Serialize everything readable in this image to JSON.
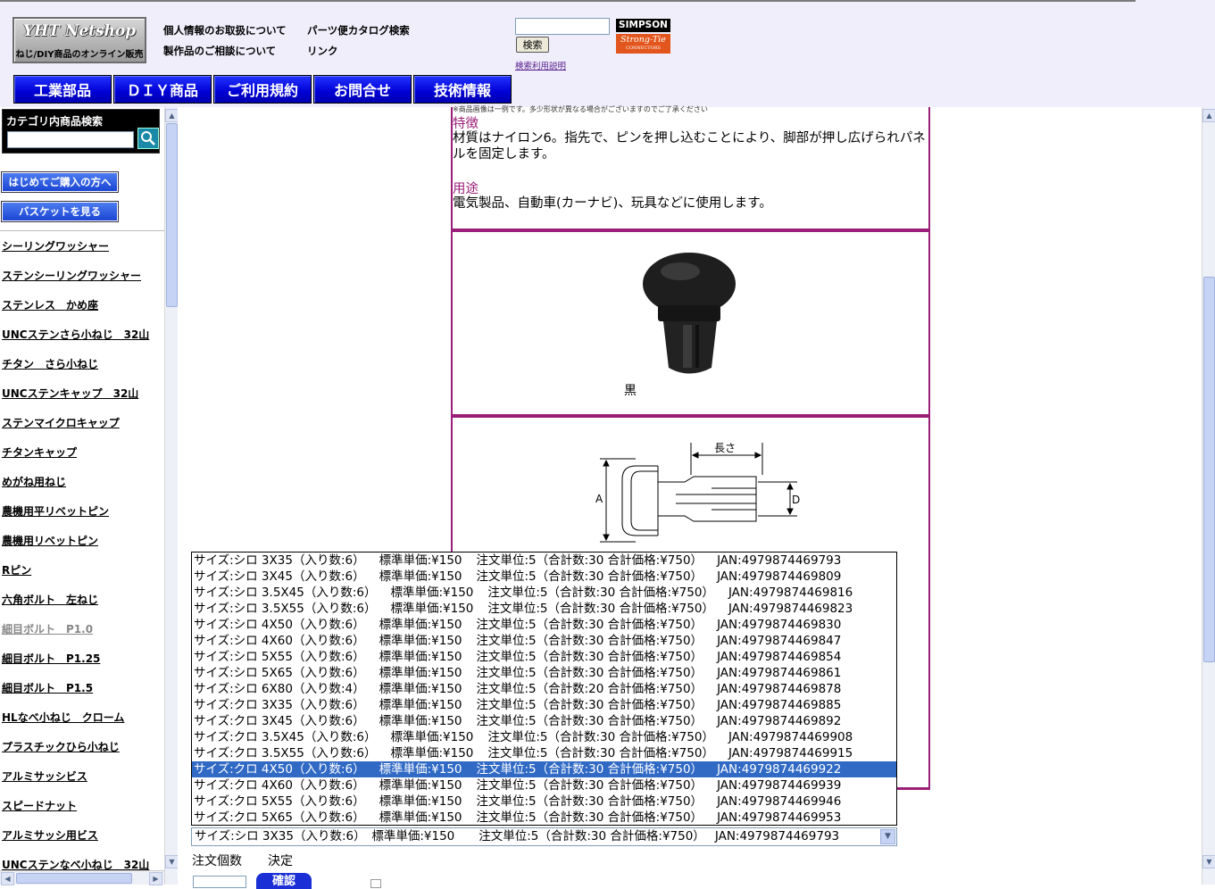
{
  "header": {
    "logo_title": "YHT Netshop",
    "logo_subtitle": "ねじ/DIY商品のオンライン販売",
    "links": [
      "個人情報のお取扱について",
      "製作品のご相談について",
      "パーツ便カタログ検索",
      "リンク"
    ],
    "search_value": "",
    "search_button": "検索",
    "search_help": "検索利用説明",
    "simpson_top": "SIMPSON",
    "simpson_bottom": "Strong-Tie",
    "simpson_small": "CONNECTORS",
    "nav": [
      "工業部品",
      "ＤＩＹ商品",
      "ご利用規約",
      "お問合せ",
      "技術情報"
    ]
  },
  "sidebar": {
    "search_title": "カテゴリ内商品検索",
    "first_purchase": "はじめてご購入の方へ",
    "view_basket": "バスケットを見る",
    "categories": [
      "シーリングワッシャー",
      "ステンシーリングワッシャー",
      "ステンレス　かめ座",
      "UNCステンさら小ねじ　32山",
      "チタン　さら小ねじ",
      "UNCステンキャップ　32山",
      "ステンマイクロキャップ",
      "チタンキャップ",
      "めがね用ねじ",
      "農機用平リベットピン",
      "農機用リベットピン",
      "Rピン",
      "六角ボルト　左ねじ",
      "細目ボルト　P1.0",
      "細目ボルト　P1.25",
      "細目ボルト　P1.5",
      "HLなべ小ねじ　クローム",
      "プラスチックひら小ねじ",
      "アルミサッシビス",
      "スピードナット",
      "アルミサッシ用ビス",
      "UNCステンなべ小ねじ　32山"
    ],
    "visited_index": 13
  },
  "product": {
    "note": "※商品画像は一例です。多少形状が異なる場合がございますのでご了承ください",
    "feature_title": "特徴",
    "feature_text": "材質はナイロン6。指先で、ピンを押し込むことにより、脚部が押し広げられパネルを固定します。",
    "use_title": "用途",
    "use_text": "電気製品、自動車(カーナビ)、玩具などに使用します。",
    "color_label": "黒",
    "diagram_length": "長さ",
    "diagram_a": "A",
    "diagram_d": "D"
  },
  "options": [
    {
      "size": "サイズ:シロ 3X35（入り数:6）",
      "price": "標準単価:¥150",
      "order": "注文単位:5（合計数:30 合計価格:¥750）",
      "jan": "JAN:4979874469793"
    },
    {
      "size": "サイズ:シロ 3X45（入り数:6）",
      "price": "標準単価:¥150",
      "order": "注文単位:5（合計数:30 合計価格:¥750）",
      "jan": "JAN:4979874469809"
    },
    {
      "size": "サイズ:シロ 3.5X45（入り数:6）",
      "price": "標準単価:¥150",
      "order": "注文単位:5（合計数:30 合計価格:¥750）",
      "jan": "JAN:4979874469816"
    },
    {
      "size": "サイズ:シロ 3.5X55（入り数:6）",
      "price": "標準単価:¥150",
      "order": "注文単位:5（合計数:30 合計価格:¥750）",
      "jan": "JAN:4979874469823"
    },
    {
      "size": "サイズ:シロ 4X50（入り数:6）",
      "price": "標準単価:¥150",
      "order": "注文単位:5（合計数:30 合計価格:¥750）",
      "jan": "JAN:4979874469830"
    },
    {
      "size": "サイズ:シロ 4X60（入り数:6）",
      "price": "標準単価:¥150",
      "order": "注文単位:5（合計数:30 合計価格:¥750）",
      "jan": "JAN:4979874469847"
    },
    {
      "size": "サイズ:シロ 5X55（入り数:6）",
      "price": "標準単価:¥150",
      "order": "注文単位:5（合計数:30 合計価格:¥750）",
      "jan": "JAN:4979874469854"
    },
    {
      "size": "サイズ:シロ 5X65（入り数:6）",
      "price": "標準単価:¥150",
      "order": "注文単位:5（合計数:30 合計価格:¥750）",
      "jan": "JAN:4979874469861"
    },
    {
      "size": "サイズ:シロ 6X80（入り数:4）",
      "price": "標準単価:¥150",
      "order": "注文単位:5（合計数:20 合計価格:¥750）",
      "jan": "JAN:4979874469878"
    },
    {
      "size": "サイズ:クロ 3X35（入り数:6）",
      "price": "標準単価:¥150",
      "order": "注文単位:5（合計数:30 合計価格:¥750）",
      "jan": "JAN:4979874469885"
    },
    {
      "size": "サイズ:クロ 3X45（入り数:6）",
      "price": "標準単価:¥150",
      "order": "注文単位:5（合計数:30 合計価格:¥750）",
      "jan": "JAN:4979874469892"
    },
    {
      "size": "サイズ:クロ 3.5X45（入り数:6）",
      "price": "標準単価:¥150",
      "order": "注文単位:5（合計数:30 合計価格:¥750）",
      "jan": "JAN:4979874469908"
    },
    {
      "size": "サイズ:クロ 3.5X55（入り数:6）",
      "price": "標準単価:¥150",
      "order": "注文単位:5（合計数:30 合計価格:¥750）",
      "jan": "JAN:4979874469915"
    },
    {
      "size": "サイズ:クロ 4X50（入り数:6）",
      "price": "標準単価:¥150",
      "order": "注文単位:5（合計数:30 合計価格:¥750）",
      "jan": "JAN:4979874469922"
    },
    {
      "size": "サイズ:クロ 4X60（入り数:6）",
      "price": "標準単価:¥150",
      "order": "注文単位:5（合計数:30 合計価格:¥750）",
      "jan": "JAN:4979874469939"
    },
    {
      "size": "サイズ:クロ 5X55（入り数:6）",
      "price": "標準単価:¥150",
      "order": "注文単位:5（合計数:30 合計価格:¥750）",
      "jan": "JAN:4979874469946"
    },
    {
      "size": "サイズ:クロ 5X65（入り数:6）",
      "price": "標準単価:¥150",
      "order": "注文単位:5（合計数:30 合計価格:¥750）",
      "jan": "JAN:4979874469953"
    }
  ],
  "highlighted_option": 13,
  "selected_value": "サイズ:シロ 3X35（入り数:6）　標準単価:¥150　　注文単位:5（合計数:30 合計価格:¥750）　 JAN:4979874469793",
  "order": {
    "qty_label": "注文個数",
    "decide_label": "決定",
    "confirm_button": "確認"
  },
  "colors": {
    "accent": "#9a1f78",
    "nav_blue": "#0000d4",
    "highlight": "#316ac5",
    "header_bg": "#f0eefb"
  }
}
